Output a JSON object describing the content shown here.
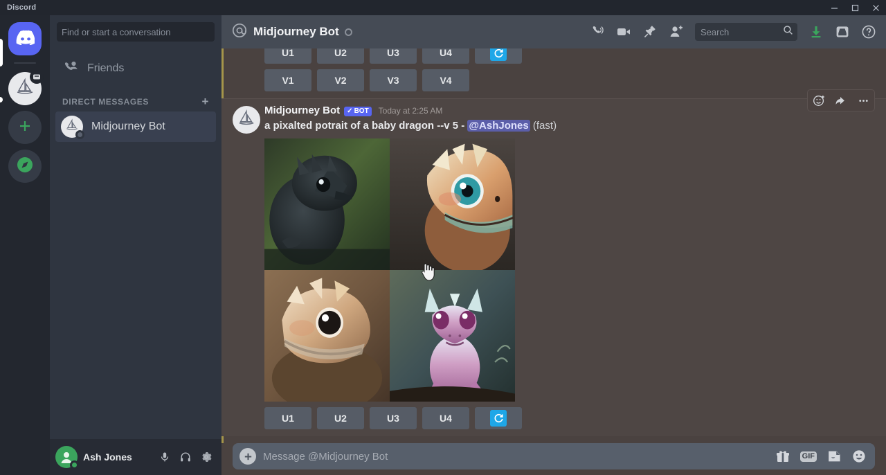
{
  "window": {
    "brand": "Discord",
    "controls": [
      {
        "name": "minimize-button",
        "label": "—"
      },
      {
        "name": "maximize-button",
        "label": "□"
      },
      {
        "name": "close-button",
        "label": "✕"
      }
    ]
  },
  "rail": {
    "items": [
      {
        "name": "home-button",
        "label": "Discord Home",
        "icon": "discord-logo-icon"
      },
      {
        "name": "server-midjourney",
        "label": "Midjourney",
        "icon": "sailboat-icon"
      },
      {
        "name": "add-server-button",
        "label": "Add a Server",
        "icon": "plus-icon"
      },
      {
        "name": "explore-servers-button",
        "label": "Explore Discoverable Servers",
        "icon": "compass-icon"
      }
    ]
  },
  "sidebar": {
    "search_placeholder": "Find or start a conversation",
    "friends_label": "Friends",
    "dm_header": "DIRECT MESSAGES",
    "dm_add_label": "+",
    "dms": [
      {
        "name": "Midjourney Bot",
        "status": "offline"
      }
    ]
  },
  "user_panel": {
    "name": "Ash Jones",
    "icons": [
      "microphone-icon",
      "headphones-icon",
      "gear-icon"
    ]
  },
  "header": {
    "at_icon": "at-sign-icon",
    "title": "Midjourney Bot",
    "icons": [
      {
        "name": "start-call-icon",
        "label": "Start Voice Call"
      },
      {
        "name": "video-call-icon",
        "label": "Start Video Call"
      },
      {
        "name": "pinned-messages-icon",
        "label": "Pinned Messages"
      },
      {
        "name": "add-friends-icon",
        "label": "Add Friends to DM"
      }
    ],
    "search_placeholder": "Search",
    "right_icons": [
      {
        "name": "downloads-icon",
        "label": "Downloads",
        "color": "#3ba55d"
      },
      {
        "name": "inbox-icon",
        "label": "Inbox"
      },
      {
        "name": "help-icon",
        "label": "Help"
      }
    ]
  },
  "messages": {
    "previous": {
      "upscale_buttons": [
        "U1",
        "U2",
        "U3",
        "U4"
      ],
      "redo_label": "redo-icon",
      "variation_buttons": [
        "V1",
        "V2",
        "V3",
        "V4"
      ]
    },
    "current": {
      "author": "Midjourney Bot",
      "bot_tag": "BOT",
      "bot_tag_check": "✓",
      "timestamp": "Today at 2:25 AM",
      "prompt": "a pixalted potrait of a baby dragon --v 5 -",
      "mention": "@AshJones",
      "suffix": "(fast)",
      "image_alt": "four baby dragon portraits grid",
      "upscale_buttons": [
        "U1",
        "U2",
        "U3",
        "U4"
      ],
      "redo_label": "redo-icon",
      "actions": [
        {
          "name": "add-reaction-icon",
          "label": "Add Reaction"
        },
        {
          "name": "reply-icon",
          "label": "Reply"
        },
        {
          "name": "more-options-icon",
          "label": "More"
        }
      ]
    }
  },
  "composer": {
    "placeholder": "Message @Midjourney Bot",
    "plus_label": "+",
    "gif_label": "GIF",
    "icons": [
      "gift-icon",
      "gif-icon",
      "sticker-icon",
      "emoji-icon"
    ]
  },
  "colors": {
    "brand": "#5865f2",
    "accent_green": "#3ba55d",
    "redo_blue": "#1ea7e8",
    "scroll_marker": "#a5954a",
    "chat_bg": "#4a4240",
    "sidebar_bg": "#2f3540"
  }
}
